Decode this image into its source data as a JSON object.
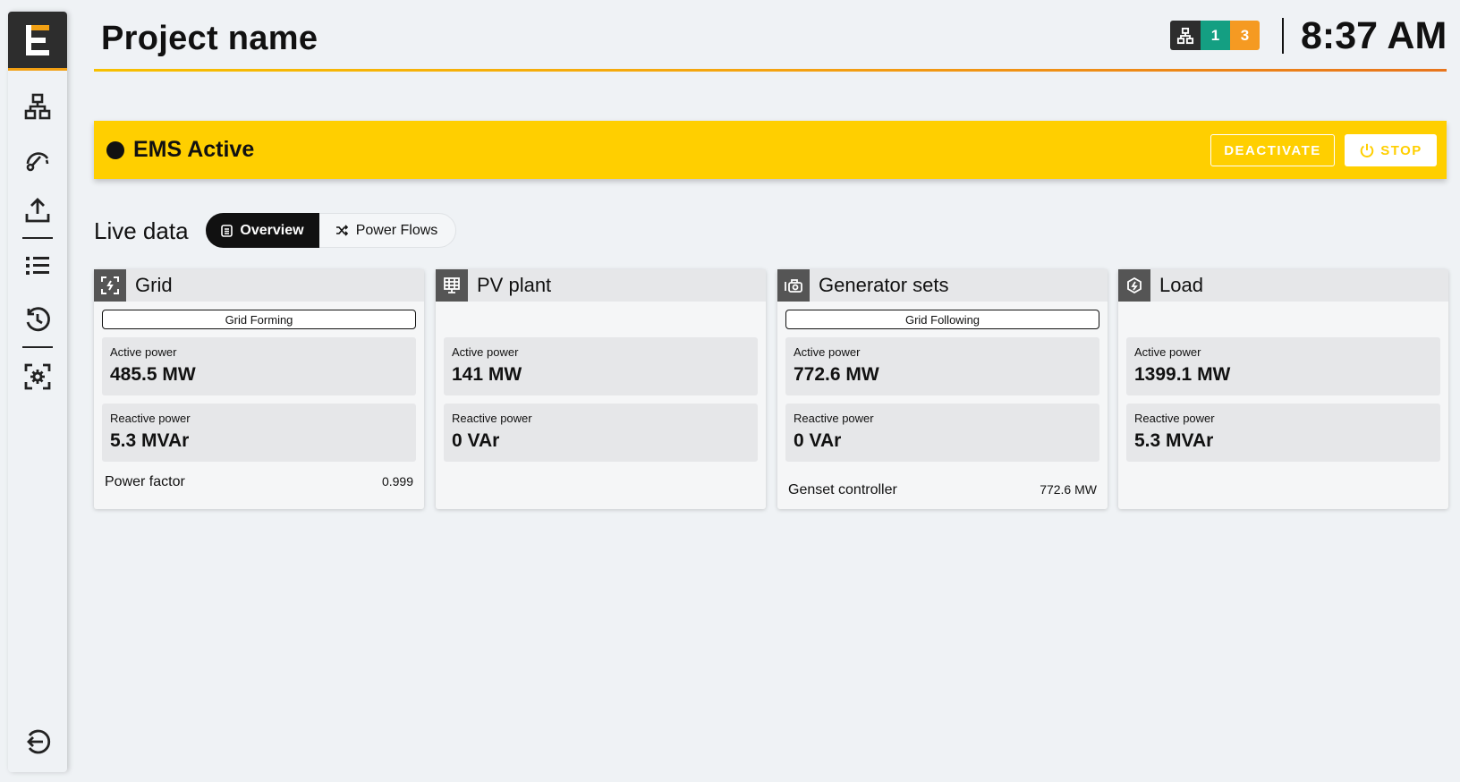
{
  "sidebar": {
    "logo_letter": "E",
    "items": [
      {
        "name": "sitemap-icon"
      },
      {
        "name": "gauge-icon"
      },
      {
        "name": "upload-icon"
      },
      {
        "name": "list-icon"
      },
      {
        "name": "history-icon"
      },
      {
        "name": "focus-settings-icon"
      },
      {
        "name": "logout-icon"
      }
    ]
  },
  "header": {
    "title": "Project name",
    "status": {
      "icon": "sitemap-icon",
      "count_ok": "1",
      "count_warn": "3",
      "color_ok": "#149f82",
      "color_warn": "#f59a22"
    },
    "clock": "8:37 AM"
  },
  "ems": {
    "label": "EMS Active",
    "color": "#ffcf00",
    "deactivate_label": "DEACTIVATE",
    "stop_label": "STOP"
  },
  "live": {
    "title": "Live data",
    "tabs": [
      {
        "label": "Overview",
        "icon": "list-doc-icon",
        "active": true
      },
      {
        "label": "Power Flows",
        "icon": "shuffle-icon",
        "active": false
      }
    ]
  },
  "cards": [
    {
      "title": "Grid",
      "icon": "grid-icon",
      "mode": "Grid Forming",
      "active_label": "Active power",
      "active_value": "485.5 MW",
      "reactive_label": "Reactive power",
      "reactive_value": "5.3 MVAr",
      "foot_label": "Power factor",
      "foot_value": "0.999"
    },
    {
      "title": "PV plant",
      "icon": "solar-panel-icon",
      "active_label": "Active power",
      "active_value": "141 MW",
      "reactive_label": "Reactive power",
      "reactive_value": "0 VAr"
    },
    {
      "title": "Generator sets",
      "icon": "generator-icon",
      "mode": "Grid Following",
      "active_label": "Active power",
      "active_value": "772.6 MW",
      "reactive_label": "Reactive power",
      "reactive_value": "0 VAr",
      "foot_label": "Genset controller",
      "foot_value": "772.6 MW"
    },
    {
      "title": "Load",
      "icon": "load-house-icon",
      "active_label": "Active power",
      "active_value": "1399.1 MW",
      "reactive_label": "Reactive power",
      "reactive_value": "5.3 MVAr"
    }
  ]
}
